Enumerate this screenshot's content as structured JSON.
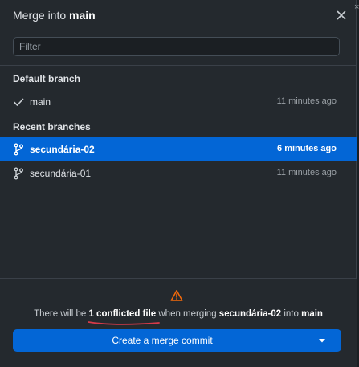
{
  "dialog": {
    "title_prefix": "Merge into",
    "title_branch": "main",
    "close_label": "×"
  },
  "filter": {
    "placeholder": "Filter",
    "value": ""
  },
  "groups": [
    {
      "label": "Default branch",
      "branches": [
        {
          "name": "main",
          "time": "11 minutes ago",
          "icon": "check-icon",
          "selected": false
        }
      ]
    },
    {
      "label": "Recent branches",
      "branches": [
        {
          "name": "secundária-02",
          "time": "6 minutes ago",
          "icon": "git-branch-icon",
          "selected": true
        },
        {
          "name": "secundária-01",
          "time": "11 minutes ago",
          "icon": "git-branch-icon",
          "selected": false
        }
      ]
    }
  ],
  "footer": {
    "warning_icon": "alert-triangle-icon",
    "warning_color": "#f66a0a",
    "annotation_color": "#d73a49",
    "message": {
      "part1": "There will be ",
      "conflict": "1 conflicted file",
      "part2": " when merging ",
      "source": "secundária-02",
      "part3": " into ",
      "target": "main"
    },
    "merge_button_label": "Create a merge commit",
    "merge_caret_icon": "triangle-down-icon"
  },
  "colors": {
    "accent": "#0366d6",
    "background": "#24292e"
  }
}
